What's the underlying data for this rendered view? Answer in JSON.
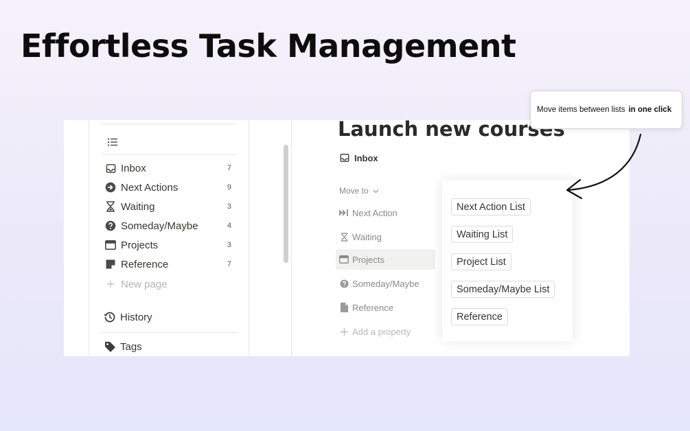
{
  "headline": "Effortless Task Management",
  "sidebar": {
    "items": [
      {
        "label": "Inbox",
        "count": "7",
        "icon": "inbox-tray-icon"
      },
      {
        "label": "Next Actions",
        "count": "9",
        "icon": "arrow-circle-right-icon"
      },
      {
        "label": "Waiting",
        "count": "3",
        "icon": "hourglass-icon"
      },
      {
        "label": "Someday/Maybe",
        "count": "4",
        "icon": "question-circle-icon"
      },
      {
        "label": "Projects",
        "count": "3",
        "icon": "browser-window-icon"
      },
      {
        "label": "Reference",
        "count": "7",
        "icon": "note-page-icon"
      }
    ],
    "new_page": "New page",
    "history": "History",
    "tags": "Tags"
  },
  "page": {
    "title": "Launch new courses",
    "status": "Inbox",
    "move_to": "Move to",
    "properties": [
      {
        "label": "Next Action",
        "icon": "fast-forward-icon"
      },
      {
        "label": "Waiting",
        "icon": "hourglass-icon"
      },
      {
        "label": "Projects",
        "icon": "browser-window-icon"
      },
      {
        "label": "Someday/Maybe",
        "icon": "question-circle-icon"
      },
      {
        "label": "Reference",
        "icon": "document-icon"
      }
    ],
    "add_property": "Add a property"
  },
  "popover": {
    "options": [
      "Next Action List",
      "Waiting List",
      "Project List",
      "Someday/Maybe List",
      "Reference"
    ]
  },
  "callout": {
    "text": "Move items between lists",
    "emphasis": "in one click"
  },
  "colors": {
    "text": "#37352f",
    "muted": "#8a8a86",
    "headline": "#0d0d0d"
  }
}
